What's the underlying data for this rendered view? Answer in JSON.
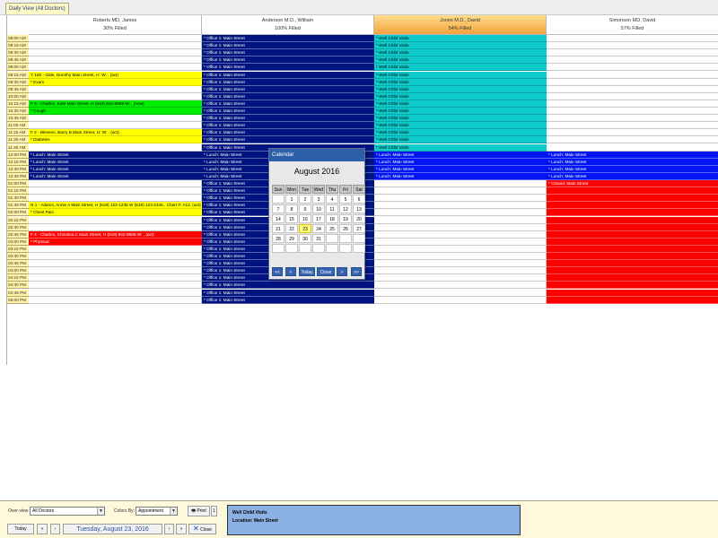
{
  "tabs": [
    {
      "label": "Daily View (All Doctors)"
    }
  ],
  "doctors": [
    {
      "name": "Roberts MD, James",
      "status": "30% Filled",
      "selected": false
    },
    {
      "name": "Anderson M.D., William",
      "status": "100% Filled",
      "selected": false
    },
    {
      "name": "Jones M.D., David",
      "status": "54% Filled",
      "selected": true
    },
    {
      "name": "Simonson MD, David",
      "status": "57% Filled",
      "selected": false
    }
  ],
  "times": [
    "08:00 AM",
    "08:15 AM",
    "08:30 AM",
    "08:45 AM",
    "09:00 AM",
    "09:15 AM",
    "09:30 AM",
    "09:45 AM",
    "10:00 AM",
    "10:15 AM",
    "10:30 AM",
    "10:45 AM",
    "11:00 AM",
    "11:15 AM",
    "11:30 AM",
    "11:45 AM",
    "12:00 PM",
    "12:15 PM",
    "12:30 PM",
    "12:45 PM",
    "01:00 PM",
    "01:15 PM",
    "01:30 PM",
    "01:45 PM",
    "02:00 PM",
    "02:15 PM",
    "02:30 PM",
    "02:45 PM",
    "03:00 PM",
    "03:15 PM",
    "03:30 PM",
    "03:45 PM",
    "04:00 PM",
    "04:15 PM",
    "04:30 PM",
    "04:45 PM",
    "05:00 PM"
  ],
  "appointments": [
    {
      "doc": 0,
      "row": 5,
      "text": "Y 150 - Gale, Dorothy Main Street, H: W: , (act)",
      "color": "yellow"
    },
    {
      "doc": 0,
      "row": 6,
      "text": "* Exam",
      "color": "yellow"
    },
    {
      "doc": 0,
      "row": 9,
      "text": "F 6 - Charles, Kate Main Street, H (619) 842-8569 W: , (new)",
      "color": "green"
    },
    {
      "doc": 0,
      "row": 10,
      "text": "* Cough",
      "color": "green"
    },
    {
      "doc": 0,
      "row": 13,
      "text": "F 2 - Blevens, Barry B Main Street, H: W: , (act)",
      "color": "yellow"
    },
    {
      "doc": 0,
      "row": 14,
      "text": "* Diabetes",
      "color": "yellow"
    },
    {
      "doc": 0,
      "row": 16,
      "text": "* Lunch: Main Street",
      "color": "navy"
    },
    {
      "doc": 0,
      "row": 17,
      "text": "* Lunch: Main Street",
      "color": "navy"
    },
    {
      "doc": 0,
      "row": 18,
      "text": "* Lunch: Main Street",
      "color": "navy"
    },
    {
      "doc": 0,
      "row": 19,
      "text": "* Lunch: Main Street",
      "color": "navy"
    },
    {
      "doc": 0,
      "row": 23,
      "text": "N 1 - Adams, Annie A Main Street, H (619) 123-1235 W (619) 123-2345 , Chart #: A12, (act)",
      "color": "yellow"
    },
    {
      "doc": 0,
      "row": 24,
      "text": "* Chest Pain",
      "color": "yellow"
    },
    {
      "doc": 0,
      "row": 27,
      "text": "F 4 - Charles, Christina C Main Street, H (619) 842-8565 W: , (act)",
      "color": "red"
    },
    {
      "doc": 0,
      "row": 28,
      "text": "* Physical",
      "color": "red"
    },
    {
      "doc": 1,
      "fromRow": 0,
      "toRow": 15,
      "text": "* Office 1: Main Street",
      "color": "navy"
    },
    {
      "doc": 1,
      "fromRow": 16,
      "toRow": 19,
      "text": "* Lunch: Main Street",
      "color": "navy"
    },
    {
      "doc": 1,
      "fromRow": 20,
      "toRow": 36,
      "text": "* Office 1: Main Street",
      "color": "navy"
    },
    {
      "doc": 2,
      "fromRow": 0,
      "toRow": 15,
      "text": "* Well Child Visits",
      "color": "teal"
    },
    {
      "doc": 2,
      "fromRow": 16,
      "toRow": 19,
      "text": "* Lunch: Main Street",
      "color": "blue"
    },
    {
      "doc": 3,
      "fromRow": 16,
      "toRow": 19,
      "text": "* Lunch: Main Street",
      "color": "blue"
    },
    {
      "doc": 3,
      "row": 20,
      "text": "* Closed: Main Street",
      "color": "red"
    },
    {
      "doc": 3,
      "fromRow": 21,
      "toRow": 36,
      "text": "",
      "color": "red"
    }
  ],
  "calendar": {
    "title": "Calendar",
    "month_label": "August 2016",
    "weekdays": [
      "Sun",
      "Mon",
      "Tue",
      "Wed",
      "Thu",
      "Fri",
      "Sat"
    ],
    "weeks": [
      [
        "",
        "1",
        "2",
        "3",
        "4",
        "5",
        "6"
      ],
      [
        "7",
        "8",
        "9",
        "10",
        "11",
        "12",
        "13"
      ],
      [
        "14",
        "15",
        "16",
        "17",
        "18",
        "19",
        "20"
      ],
      [
        "21",
        "22",
        "23",
        "24",
        "25",
        "26",
        "27"
      ],
      [
        "28",
        "29",
        "30",
        "31",
        "",
        "",
        ""
      ],
      [
        "",
        "",
        "",
        "",
        "",
        "",
        ""
      ]
    ],
    "selected_day": "23",
    "buttons": [
      "<<",
      "<",
      "Today",
      "Close",
      ">",
      ">>"
    ]
  },
  "bottom": {
    "overview_label": "Over-view",
    "overview_value": "All Doctors",
    "colors_label": "Colors By:",
    "colors_value": "Appointment",
    "print_label": "Print",
    "print_count": "1",
    "today_label": "Today",
    "date_label": "Tuesday, August 23, 2016",
    "close_label": "Close",
    "info_line1": "Well Child Visits",
    "info_line2": "Location: Main Street"
  },
  "colors": {
    "navy": "#00137f",
    "teal": "#0ecbcb",
    "blue": "#0015f2",
    "yellow": "#ffff00",
    "green": "#00ee00",
    "red": "#ff0000"
  }
}
